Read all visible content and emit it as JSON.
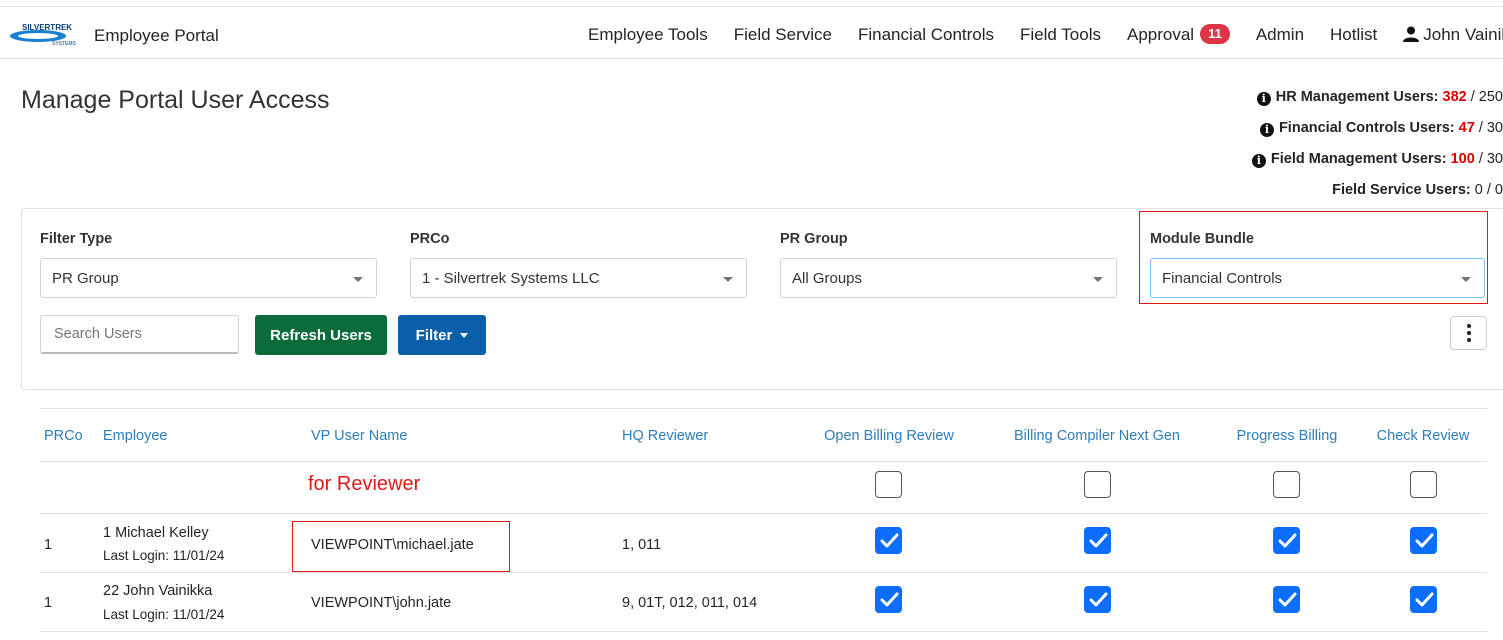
{
  "navbar": {
    "brand": "Employee Portal",
    "logo_text": "SILVERTREK SYSTEMS",
    "items": [
      "Employee Tools",
      "Field Service",
      "Financial Controls",
      "Field Tools",
      "Approval",
      "Admin",
      "Hotlist"
    ],
    "approval_badge": "11",
    "user": "John Vainikka"
  },
  "page": {
    "title": "Manage Portal User Access"
  },
  "licenses": [
    {
      "label": "HR Management Users:",
      "used": "382",
      "total": "/ 250",
      "info": true
    },
    {
      "label": "Financial Controls Users:",
      "used": "47",
      "total": "/ 30",
      "info": true
    },
    {
      "label": "Field Management Users:",
      "used": "100",
      "total": "/ 30",
      "info": true
    },
    {
      "label": "Field Service Users:",
      "used": "0",
      "total": "/ 0",
      "info": false
    }
  ],
  "filters": {
    "filter_type_label": "Filter Type",
    "filter_type_value": "PR Group",
    "prco_label": "PRCo",
    "prco_value": "1 - Silvertrek Systems LLC",
    "pr_group_label": "PR Group",
    "pr_group_value": "All Groups",
    "module_bundle_label": "Module Bundle",
    "module_bundle_value": "Financial Controls",
    "search_placeholder": "Search Users",
    "refresh_label": "Refresh Users",
    "filter_label": "Filter"
  },
  "table": {
    "headers": {
      "prco": "PRCo",
      "employee": "Employee",
      "vp_user": "VP User Name",
      "hq_reviewer": "HQ Reviewer",
      "mod1": "Open Billing Review",
      "mod2": "Billing Compiler Next Gen",
      "mod3": "Progress Billing",
      "mod4": "Check Review"
    },
    "annotation": "for Reviewer",
    "select_all": [
      false,
      false,
      false,
      false
    ],
    "rows": [
      {
        "prco": "1",
        "employee": "1 Michael Kelley",
        "last_login": "Last Login: 11/01/24",
        "vp_user": "VIEWPOINT\\michael.jate",
        "hq_reviewer": "1, 011",
        "modules": [
          true,
          true,
          true,
          true
        ]
      },
      {
        "prco": "1",
        "employee": "22 John Vainikka",
        "last_login": "Last Login: 11/01/24",
        "vp_user": "VIEWPOINT\\john.jate",
        "hq_reviewer": "9, 01T, 012, 011, 014",
        "modules": [
          true,
          true,
          true,
          true
        ]
      }
    ]
  },
  "colors": {
    "accent": "#0d6efd",
    "green_button": "#0b6b3a",
    "blue_button": "#0b5ea8",
    "alert_red": "#dc3545",
    "header_blue": "#2e7db8",
    "annotation_red": "#dd1a1a"
  }
}
